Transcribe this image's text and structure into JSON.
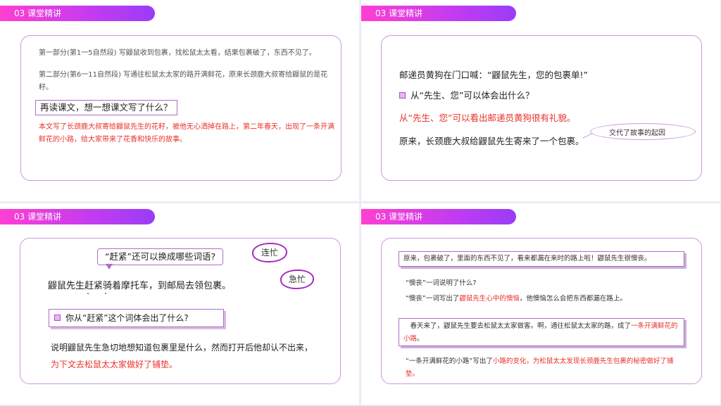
{
  "section_label": "03 课堂精讲",
  "slide1": {
    "para1": "第一部分(第1一5自然段) 写鼹鼠收到包裹，找松鼠太太看，结果包裹破了，东西不见了。",
    "para2": "第二部分(第6一11自然段) 写通往松鼠太太家的路开满鲜花，原来长颈鹿大叔寄给鼹鼠的是花籽。",
    "question": "再读课文，想一想课文写了什么？",
    "answer": "本文写了长颈鹿大叔寄给鼹鼠先生的花籽，被他无心洒掉在路上，第二年春天，出现了一条开满鲜花的小路，给大家带来了花香和快乐的故事。"
  },
  "slide2": {
    "line1": "邮递员黄狗在门口喊：“鼹鼠先生，您的包裹单!”",
    "line2": "从“先生、您”可以体会出什么？",
    "line3": "从“先生、您”可以看出邮递员黄狗很有礼貌。",
    "line4": "原来，长颈鹿大叔给鼹鼠先生寄来了一个包裹。",
    "oval_note": "交代了故事的起因"
  },
  "slide3": {
    "bubble": "“赶紧”还可以换成哪些词语?",
    "cloud1": "连忙",
    "cloud2": "急忙",
    "main": "鼹鼠先生赶紧骑着摩托车，到邮局去领包裹。",
    "question": "你从“赶紧”这个词体会出了什么?",
    "answer1": "说明鼹鼠先生急切地想知道包裹里是什么，然而打开后他却认不出来，",
    "answer2": "为下文去松鼠太太家做好了铺垫。"
  },
  "slide4": {
    "box1": "原来，包裹破了，里面的东西不见了，看来都漏在来时的路上啦！鼹鼠先生很懊丧。",
    "q1": "“懊丧”一词说明了什么?",
    "q2_prefix": "“懊丧”一词写出了",
    "q2_red": "鼹鼠先生心中的懊恼",
    "q2_suffix": "，他懊恼怎么会把东西都漏在路上。",
    "box2_prefix": "　春天来了，鼹鼠先生要去松鼠太太家做客。啊，通往松鼠太太家的路，成了",
    "box2_red": "一条开满鲜花的小路",
    "box2_suffix": "。",
    "q3_prefix": "“一条开满鲜花的小路”写出了",
    "q3_red": "小路的变化，为松鼠太太发现长颈鹿先生包裹的秘密做好了铺垫。"
  }
}
